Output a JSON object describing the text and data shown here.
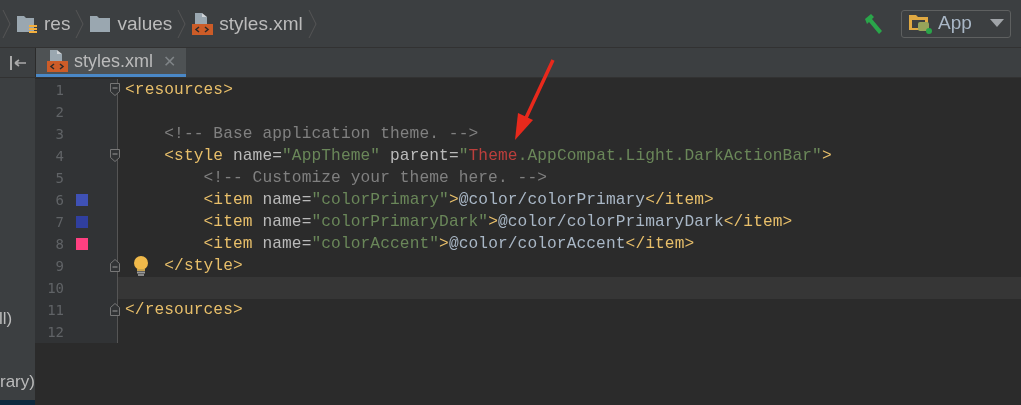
{
  "breadcrumb": {
    "items": [
      {
        "label": "res",
        "kind": "res-folder"
      },
      {
        "label": "values",
        "kind": "folder"
      },
      {
        "label": "styles.xml",
        "kind": "xml-file"
      }
    ]
  },
  "toolbar": {
    "run_config": {
      "label": "App"
    }
  },
  "tabs": [
    {
      "label": "styles.xml",
      "close": "✕",
      "selected": true
    }
  ],
  "sidebar": {
    "texts": [
      "ll)",
      "rary)"
    ]
  },
  "editor": {
    "lines": [
      {
        "number": "1",
        "fold_start": true,
        "current": false,
        "tokens": [
          {
            "kind": "tag",
            "text": "<resources>"
          }
        ]
      },
      {
        "number": "2",
        "current": false
      },
      {
        "number": "3",
        "current": false,
        "tokens": [
          {
            "kind": "comment",
            "text": "    <!-- Base application theme. -->"
          }
        ]
      },
      {
        "number": "4",
        "fold_start": true,
        "current": false,
        "tokens": [
          {
            "kind": "tag",
            "text": "    <style"
          },
          {
            "kind": "attr",
            "text": " name="
          },
          {
            "kind": "value",
            "text": "\"AppTheme\""
          },
          {
            "kind": "attr",
            "text": " parent="
          },
          {
            "kind": "value",
            "text": "\""
          },
          {
            "kind": "error",
            "text": "Theme"
          },
          {
            "kind": "value",
            "text": ".AppCompat.Light.DarkActionBar\""
          },
          {
            "kind": "tag",
            "text": ">"
          }
        ]
      },
      {
        "number": "5",
        "current": false,
        "tokens": [
          {
            "kind": "comment",
            "text": "        <!-- Customize your theme here. -->"
          }
        ]
      },
      {
        "number": "6",
        "color": "#3f51b5",
        "current": false,
        "tokens": [
          {
            "kind": "tag",
            "text": "        <item"
          },
          {
            "kind": "attr",
            "text": " name="
          },
          {
            "kind": "value",
            "text": "\"colorPrimary\""
          },
          {
            "kind": "tag",
            "text": ">"
          },
          {
            "kind": "text",
            "text": "@color/colorPrimary"
          },
          {
            "kind": "tag",
            "text": "</item>"
          }
        ]
      },
      {
        "number": "7",
        "color": "#303f9f",
        "current": false,
        "tokens": [
          {
            "kind": "tag",
            "text": "        <item"
          },
          {
            "kind": "attr",
            "text": " name="
          },
          {
            "kind": "value",
            "text": "\"colorPrimaryDark\""
          },
          {
            "kind": "tag",
            "text": ">"
          },
          {
            "kind": "text",
            "text": "@color/colorPrimaryDark"
          },
          {
            "kind": "tag",
            "text": "</item>"
          }
        ]
      },
      {
        "number": "8",
        "color": "#ff4081",
        "current": false,
        "tokens": [
          {
            "kind": "tag",
            "text": "        <item"
          },
          {
            "kind": "attr",
            "text": " name="
          },
          {
            "kind": "value",
            "text": "\"colorAccent\""
          },
          {
            "kind": "tag",
            "text": ">"
          },
          {
            "kind": "text",
            "text": "@color/colorAccent"
          },
          {
            "kind": "tag",
            "text": "</item>"
          }
        ]
      },
      {
        "number": "9",
        "fold_end": true,
        "intention": true,
        "current": false,
        "tokens": [
          {
            "kind": "tag",
            "text": "    </style>"
          }
        ]
      },
      {
        "number": "10",
        "current": true
      },
      {
        "number": "11",
        "fold_end": true,
        "current": false,
        "tokens": [
          {
            "kind": "tag",
            "text": "</resources>"
          }
        ]
      },
      {
        "number": "12",
        "current": false
      }
    ]
  }
}
